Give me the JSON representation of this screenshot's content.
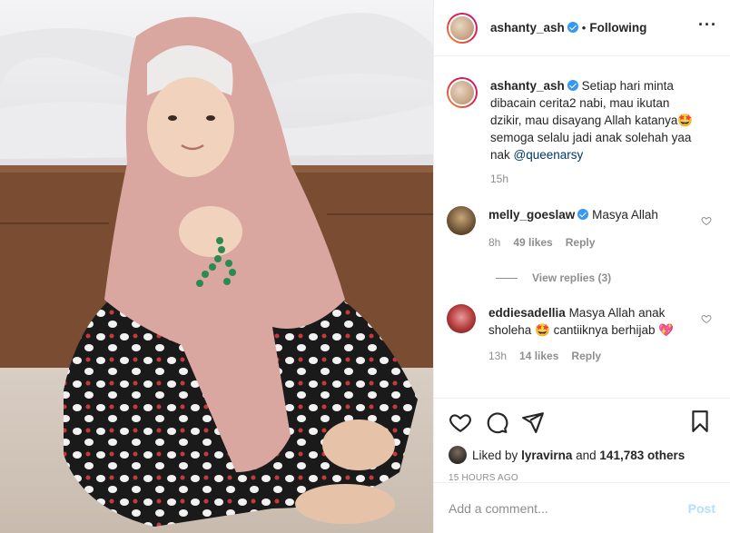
{
  "header": {
    "username": "ashanty_ash",
    "separator": "•",
    "follow_status": "Following",
    "more_icon": "more-horizontal-icon"
  },
  "caption": {
    "username": "ashanty_ash",
    "text": "Setiap hari minta dibacain cerita2 nabi, mau ikutan dzikir, mau disayang Allah katanya",
    "emoji": "🤩",
    "text2": "semoga selalu jadi anak solehah yaa nak",
    "mention": "@queenarsy",
    "time": "15h"
  },
  "comments": [
    {
      "username": "melly_goeslaw",
      "text": "Masya Allah",
      "time": "8h",
      "likes": "49 likes",
      "reply": "Reply",
      "view_replies": "View replies (3)"
    },
    {
      "username": "eddiesadellia",
      "text": "Masya Allah anak sholeha",
      "emoji1": "🤩",
      "text2": "cantiiknya berhijab",
      "emoji2": "💖",
      "time": "13h",
      "likes": "14 likes",
      "reply": "Reply"
    }
  ],
  "actions": {
    "icons": [
      "heart-icon",
      "comment-icon",
      "share-icon",
      "bookmark-icon"
    ]
  },
  "likes": {
    "prefix": "Liked by",
    "user": "lyravirna",
    "and": "and",
    "count": "141,783 others"
  },
  "timestamp": "15 HOURS AGO",
  "add_comment": {
    "placeholder": "Add a comment...",
    "post_label": "Post"
  },
  "colors": {
    "link": "#00376b",
    "verified": "#3897f0",
    "muted": "#8e8e8e",
    "post_button": "#b2dffc"
  }
}
